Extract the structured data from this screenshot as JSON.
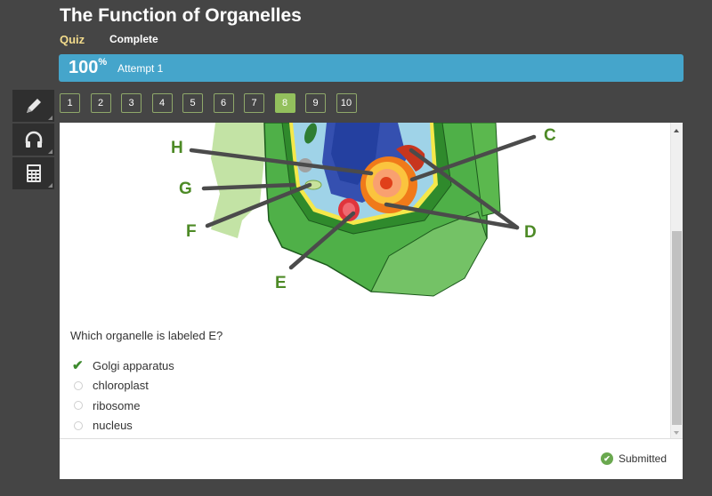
{
  "header": {
    "title": "The Function of Organelles",
    "type": "Quiz",
    "status": "Complete"
  },
  "progress": {
    "score": "100",
    "score_unit": "%",
    "attempt": "Attempt 1",
    "color": "#45a5cb"
  },
  "tools": [
    {
      "name": "pencil-icon",
      "glyph": "✎"
    },
    {
      "name": "headphones-icon",
      "glyph": "🎧"
    },
    {
      "name": "calculator-icon",
      "glyph": "▦"
    }
  ],
  "question_nav": {
    "items": [
      "1",
      "2",
      "3",
      "4",
      "5",
      "6",
      "7",
      "8",
      "9",
      "10"
    ],
    "active": "8",
    "active_color": "#93c05d"
  },
  "diagram": {
    "labels": [
      "H",
      "G",
      "F",
      "E",
      "C",
      "D"
    ]
  },
  "question": {
    "text": "Which organelle is labeled E?",
    "options": [
      {
        "label": "Golgi apparatus",
        "selected": true
      },
      {
        "label": "chloroplast",
        "selected": false
      },
      {
        "label": "ribosome",
        "selected": false
      },
      {
        "label": "nucleus",
        "selected": false
      }
    ]
  },
  "footer": {
    "status": "Submitted"
  }
}
